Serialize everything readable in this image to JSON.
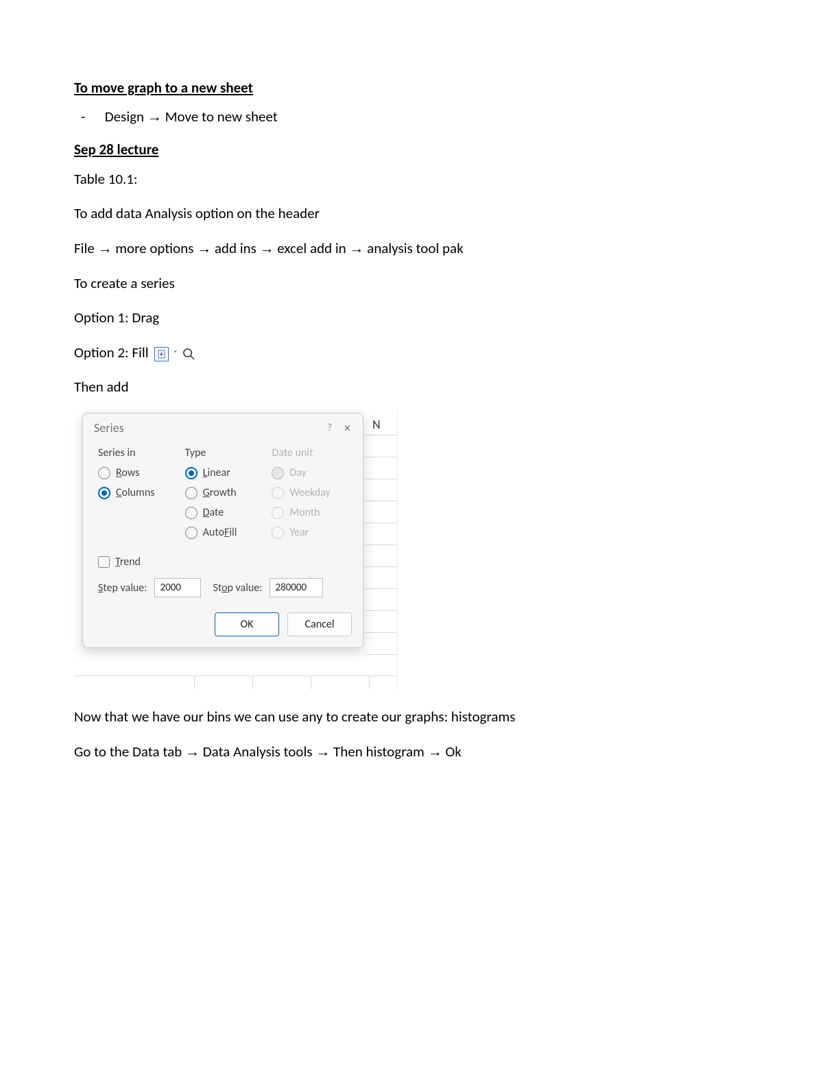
{
  "doc": {
    "heading1": "To move graph to a new sheet",
    "bullet1_pre": "Design ",
    "bullet1_post": " Move to new sheet",
    "heading2": "Sep 28 lecture",
    "line_table": "Table 10.1:",
    "line_addopt": "To add data Analysis option on the header",
    "path_file": "File ",
    "path_more": " more options ",
    "path_addins": "  add ins ",
    "path_excel": " excel add in ",
    "path_tool": " analysis tool pak",
    "line_series_intro": "To create a series",
    "line_opt1": "Option 1: Drag",
    "line_opt2_pre": "Option 2: Fill ",
    "line_thenadd": "Then add",
    "line_bins": "Now that we have our bins we can use any to create our graphs: histograms",
    "path2_a": "Go to the Data tab ",
    "path2_b": " Data Analysis tools ",
    "path2_c": " Then histogram ",
    "path2_d": " Ok",
    "arrow": "→"
  },
  "grid": {
    "col_letter": "N"
  },
  "dialog": {
    "title": "Series",
    "help": "?",
    "close": "×",
    "col1_h": "Series in",
    "col2_h": "Type",
    "col3_h": "Date unit",
    "rows_label": "Rows",
    "columns_label": "Columns",
    "linear_label": "Linear",
    "growth_label": "Growth",
    "date_label": "Date",
    "autofill_label": "AutoFill",
    "day_label": "Day",
    "weekday_label": "Weekday",
    "month_label": "Month",
    "year_label": "Year",
    "trend_label": "Trend",
    "step_label": "Step value:",
    "step_value": "2000",
    "stop_label": "Stop value:",
    "stop_value": "280000",
    "ok": "OK",
    "cancel": "Cancel"
  }
}
